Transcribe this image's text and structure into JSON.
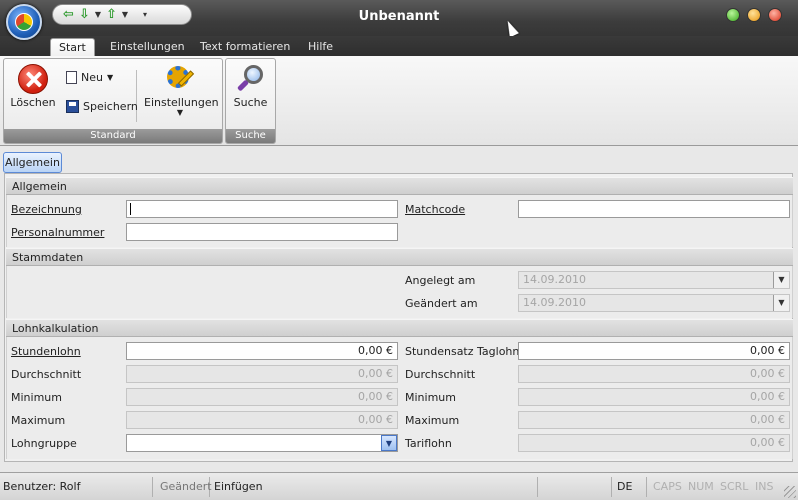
{
  "window": {
    "title": "Unbenannt"
  },
  "ribbon": {
    "tabs": [
      {
        "label": "Start"
      },
      {
        "label": "Einstellungen"
      },
      {
        "label": "Text formatieren"
      },
      {
        "label": "Hilfe"
      }
    ],
    "groups": {
      "standard": {
        "label": "Standard",
        "delete_label": "Löschen",
        "new_label": "Neu",
        "save_label": "Speichern",
        "settings_label": "Einstellungen"
      },
      "search": {
        "label": "Suche",
        "search_label": "Suche"
      }
    }
  },
  "doc_tab": {
    "label": "Allgemein"
  },
  "sections": {
    "general": {
      "title": "Allgemein",
      "bezeichnung_label": "Bezeichnung",
      "bezeichnung_value": "",
      "matchcode_label": "Matchcode",
      "matchcode_value": "",
      "personalnummer_label": "Personalnummer",
      "personalnummer_value": ""
    },
    "master": {
      "title": "Stammdaten",
      "created_label": "Angelegt am",
      "created_value": "14.09.2010",
      "changed_label": "Geändert am",
      "changed_value": "14.09.2010"
    },
    "payroll": {
      "title": "Lohnkalkulation",
      "stundenlohn_label": "Stundenlohn",
      "stundenlohn_value": "0,00 €",
      "durchschnitt_label": "Durchschnitt",
      "durchschnitt_value": "0,00 €",
      "minimum_label": "Minimum",
      "minimum_value": "0,00 €",
      "maximum_label": "Maximum",
      "maximum_value": "0,00 €",
      "lohngruppe_label": "Lohngruppe",
      "lohngruppe_value": "",
      "stundensatz_label": "Stundensatz Taglohn",
      "stundensatz_value": "0,00 €",
      "durchschnitt2_label": "Durchschnitt",
      "durchschnitt2_value": "0,00 €",
      "minimum2_label": "Minimum",
      "minimum2_value": "0,00 €",
      "maximum2_label": "Maximum",
      "maximum2_value": "0,00 €",
      "tariflohn_label": "Tariflohn",
      "tariflohn_value": "0,00 €"
    }
  },
  "statusbar": {
    "user": "Benutzer: Rolf",
    "changed": "Geändert",
    "insert": "Einfügen",
    "lang": "DE",
    "caps": "CAPS",
    "num": "NUM",
    "scrl": "SCRL",
    "ins": "INS"
  },
  "colors": {
    "accent": "#2a72d2",
    "titlebar": "#3c3c3c",
    "delete_red": "#d0200f"
  }
}
